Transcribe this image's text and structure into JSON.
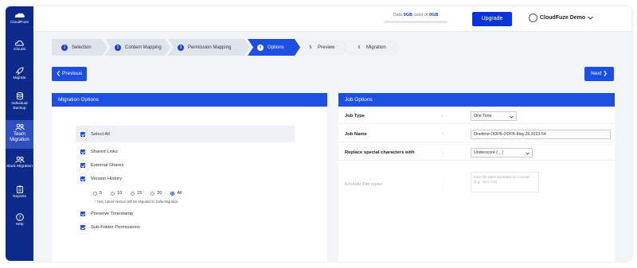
{
  "app": {
    "brand": "CloudFuze"
  },
  "sidebar": {
    "items": [
      {
        "label": "Clouds",
        "icon": "cloud-icon"
      },
      {
        "label": "Migrate",
        "icon": "rocket-icon"
      },
      {
        "label": "Individual Backup",
        "icon": "database-icon"
      },
      {
        "label": "Team Migration",
        "icon": "team-icon"
      },
      {
        "label": "Slack Migration",
        "icon": "slack-team-icon"
      },
      {
        "label": "Reports",
        "icon": "clipboard-icon"
      },
      {
        "label": "Help",
        "icon": "help-icon"
      }
    ],
    "active": "Team Migration"
  },
  "topbar": {
    "data_prefix": "Data",
    "data_used": "0GB",
    "data_mid": "used of",
    "data_total": "0GB",
    "upgrade_label": "Upgrade",
    "user_name": "CloudFuze Demo"
  },
  "steps": [
    {
      "num": "1",
      "label": "Selection"
    },
    {
      "num": "2",
      "label": "Content Mapping"
    },
    {
      "num": "3",
      "label": "Permission Mapping"
    },
    {
      "num": "4",
      "label": "Options"
    },
    {
      "num": "5",
      "label": "Preview"
    },
    {
      "num": "6",
      "label": "Migration"
    }
  ],
  "nav": {
    "prev_label": "Previous",
    "next_label": "Next"
  },
  "migration_options": {
    "title": "Migration Options",
    "select_all": "Select All",
    "shared_links": "Shared Links",
    "external_shares": "External Shares",
    "version_history": "Version History",
    "versions": [
      "5",
      "10",
      "15",
      "20",
      "All"
    ],
    "selected_version": "All",
    "version_note": "* Only Latest Version Will Be Migrated In Delta Migration",
    "preserve_timestamp": "Preserve Timestamp",
    "subfolder_permissions": "Sub-Folder Permissions"
  },
  "job_options": {
    "title": "Job Options",
    "job_type_label": "Job Type",
    "job_type_value": "One Time",
    "job_name_label": "Job Name",
    "job_name_value": "Onetime-ODFB-ODFB-May.26.2023-54",
    "replace_label": "Replace special characters with",
    "replace_value": "Underscore ( _ )",
    "exclude_label": "Exclude File types",
    "exclude_placeholder": "Enter file types separated by commas (e.g. .mp4,.exe)",
    "colon": ":"
  },
  "colors": {
    "sidebar": "#0d2a8a",
    "accent": "#1d4fe0"
  }
}
